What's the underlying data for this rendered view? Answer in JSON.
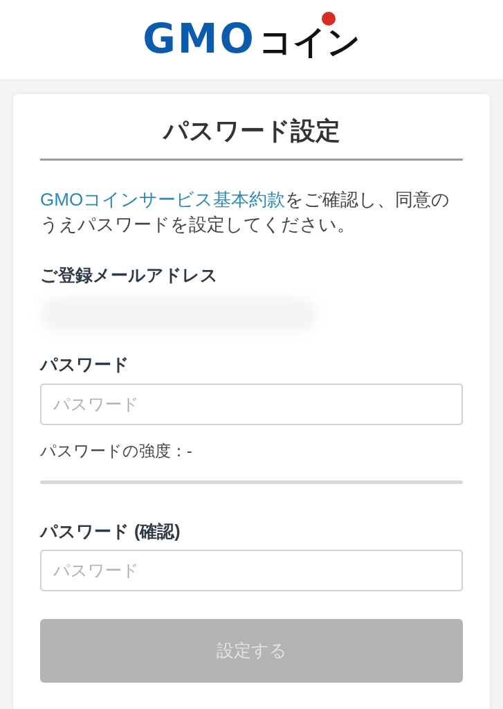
{
  "header": {
    "logo": {
      "latin": "GMO",
      "kana": "コイン"
    }
  },
  "card": {
    "title": "パスワード設定",
    "intro": {
      "link": "GMOコインサービス基本約款",
      "text": "をご確認し、同意のうえパスワードを設定してください。"
    },
    "email": {
      "label": "ご登録メールアドレス"
    },
    "password": {
      "label": "パスワード",
      "placeholder": "パスワード"
    },
    "strength": {
      "label": "パスワードの強度：-",
      "level": 0
    },
    "confirm": {
      "label": "パスワード (確認)",
      "placeholder": "パスワード"
    },
    "submit": {
      "label": "設定する",
      "disabled": true
    }
  }
}
